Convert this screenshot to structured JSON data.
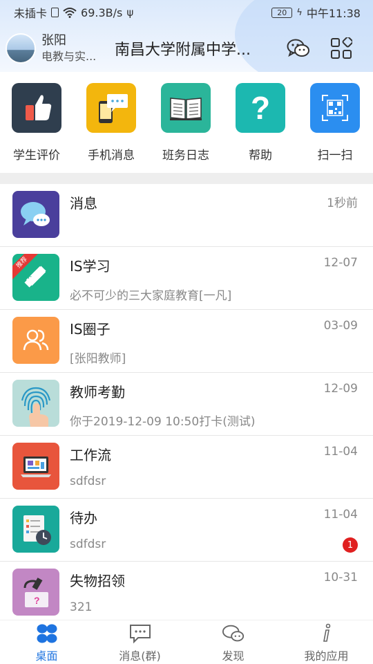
{
  "status_bar": {
    "no_sim": "未插卡",
    "speed": "69.3B/s",
    "battery": "20",
    "time": "中午11:38"
  },
  "header": {
    "user_name": "张阳",
    "user_role": "电教与实...",
    "school_name": "南昌大学附属中学...",
    "icons": [
      "wechat-icon",
      "apps-grid-icon"
    ]
  },
  "quick_actions": [
    {
      "label": "学生评价",
      "icon": "thumbs-up-icon",
      "color": "#2f3e4e"
    },
    {
      "label": "手机消息",
      "icon": "phone-message-icon",
      "color": "#f3b60d"
    },
    {
      "label": "班务日志",
      "icon": "open-book-icon",
      "color": "#2bb59a"
    },
    {
      "label": "帮助",
      "icon": "question-icon",
      "color": "#1cb8b0"
    },
    {
      "label": "扫一扫",
      "icon": "qr-scan-icon",
      "color": "#2b8ef0"
    }
  ],
  "list": [
    {
      "title": "消息",
      "time": "1秒前",
      "desc": "",
      "icon": "chat-bubbles-icon",
      "color": "#4a3f9c"
    },
    {
      "title": "IS学习",
      "time": "12-07",
      "desc": "必不可少的三大家庭教育[一凡]",
      "icon": "pencil-ruler-icon",
      "color": "#19b38a",
      "ribbon": "推荐"
    },
    {
      "title": "IS圈子",
      "time": "03-09",
      "desc": "[张阳教师]",
      "icon": "users-icon",
      "color": "#fb9a48"
    },
    {
      "title": "教师考勤",
      "time": "12-09",
      "desc": "你于2019-12-09 10:50打卡(测试)",
      "icon": "fingerprint-icon",
      "color": "#b9ddd9"
    },
    {
      "title": "工作流",
      "time": "11-04",
      "desc": "sdfdsr",
      "icon": "laptop-icon",
      "color": "#e8553c"
    },
    {
      "title": "待办",
      "time": "11-04",
      "desc": "sdfdsr",
      "icon": "todo-clock-icon",
      "color": "#19a99a",
      "badge": "1"
    },
    {
      "title": "失物招领",
      "time": "10-31",
      "desc": "321",
      "icon": "lost-found-icon",
      "color": "#c287c4"
    }
  ],
  "nav": [
    {
      "label": "桌面",
      "icon": "desktop-grid-icon",
      "active": true
    },
    {
      "label": "消息(群)",
      "icon": "message-group-icon",
      "active": false
    },
    {
      "label": "发现",
      "icon": "discover-chat-icon",
      "active": false
    },
    {
      "label": "我的应用",
      "icon": "info-i-icon",
      "active": false
    }
  ],
  "colors": {
    "accent": "#1f74e0",
    "badge": "#e02020"
  }
}
